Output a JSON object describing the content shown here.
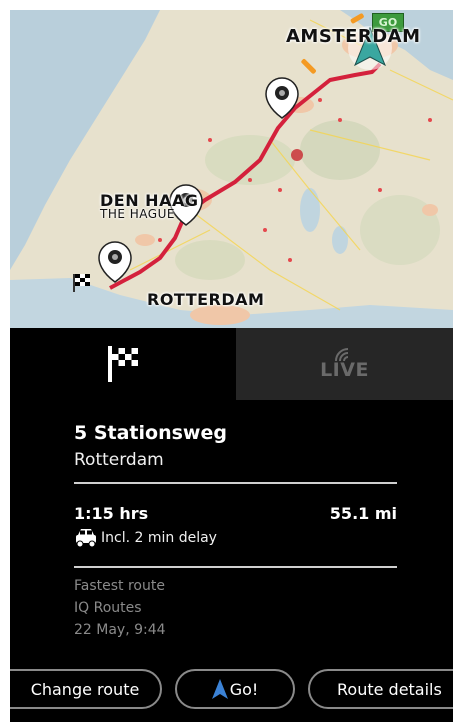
{
  "map": {
    "labels": {
      "amsterdam": "AMSTERDAM",
      "den_haag": "DEN HAAG",
      "the_hague": "THE HAGUE",
      "rotterdam": "ROTTERDAM"
    },
    "go_badge": "GO",
    "colors": {
      "land": "#e6e0cc",
      "water": "#b7ceda",
      "route": "#d4213c"
    }
  },
  "tabs": {
    "destination_icon": "checkered-flag-icon",
    "live_label": "LIVE"
  },
  "destination": {
    "street": "5 Stationsweg",
    "city": "Rotterdam"
  },
  "route_summary": {
    "duration": "1:15 hrs",
    "distance": "55.1 mi",
    "delay": "Incl. 2 min delay"
  },
  "route_meta": {
    "type": "Fastest route",
    "engine": "IQ Routes",
    "datetime": "22 May,  9:44"
  },
  "buttons": {
    "change_route": "Change route",
    "go": "Go!",
    "route_details": "Route details"
  }
}
